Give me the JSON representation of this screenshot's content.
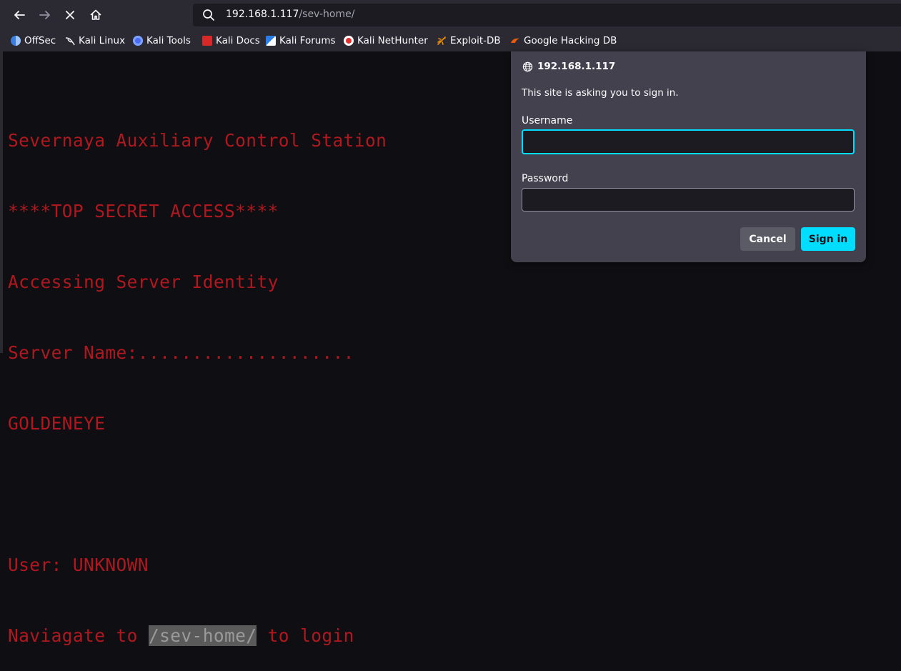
{
  "browser": {
    "back_icon": "arrow-left-icon",
    "forward_icon": "arrow-right-icon",
    "stop_icon": "close-icon",
    "home_icon": "home-icon",
    "url": {
      "host": "192.168.1.117",
      "path": "/sev-home/"
    },
    "bookmarks": [
      {
        "label": "OffSec",
        "icon": "offsec-icon",
        "color": "#3b7ddd"
      },
      {
        "label": "Kali Linux",
        "icon": "kali-dragon-icon",
        "color": "#ffffff"
      },
      {
        "label": "Kali Tools",
        "icon": "kali-tools-icon",
        "color": "#4a6cf7"
      },
      {
        "label": "Kali Docs",
        "icon": "kali-docs-icon",
        "color": "#d92828"
      },
      {
        "label": "Kali Forums",
        "icon": "kali-forums-icon",
        "color": "#2b7de9"
      },
      {
        "label": "Kali NetHunter",
        "icon": "nethunter-icon",
        "color": "#e03131"
      },
      {
        "label": "Exploit-DB",
        "icon": "exploit-db-icon",
        "color": "#f08c00"
      },
      {
        "label": "Google Hacking DB",
        "icon": "ghdb-icon",
        "color": "#e8590c"
      }
    ]
  },
  "page": {
    "lines": [
      "Severnaya Auxiliary Control Station",
      "****TOP SECRET ACCESS****",
      "Accessing Server Identity",
      "Server Name:....................",
      "GOLDENEYE",
      "",
      "User: UNKNOWN"
    ],
    "last_line_prefix": "Naviagate to ",
    "last_line_highlight": "/sev-home/",
    "last_line_suffix": " to login",
    "text_color": "#b0181f"
  },
  "dialog": {
    "origin": "192.168.1.117",
    "message": "This site is asking you to sign in.",
    "username_label": "Username",
    "username_value": "",
    "password_label": "Password",
    "password_value": "",
    "cancel_label": "Cancel",
    "signin_label": "Sign in",
    "accent_color": "#00ddff"
  }
}
